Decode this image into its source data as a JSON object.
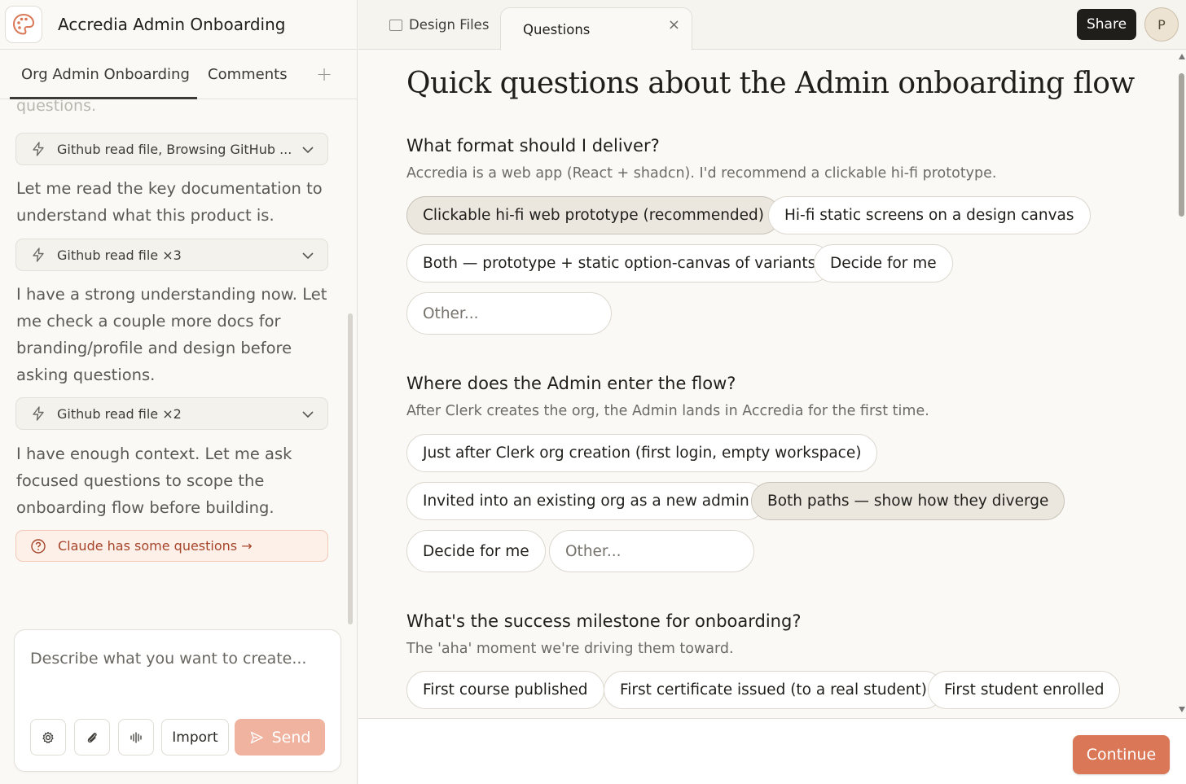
{
  "app": {
    "title": "Accredia Admin Onboarding",
    "logo_icon": "palette-icon"
  },
  "left_tabs": {
    "active": "Org Admin Onboarding",
    "second": "Comments",
    "add": "+"
  },
  "chat": {
    "faded_text": "questions.",
    "tool1": "Github read file, Browsing GitHub ...",
    "msg1": "Let me read the key documentation to understand what this product is.",
    "tool2": "Github read file ×3",
    "msg2": "I have a strong understanding now. Let me check a couple more docs for branding/profile and design before asking questions.",
    "tool3": "Github read file ×2",
    "msg3": "I have enough context. Let me ask focused questions to scope the onboarding flow before building.",
    "questions_link": "Claude has some questions →"
  },
  "composer": {
    "placeholder": "Describe what you want to create...",
    "import_label": "Import",
    "send_label": "Send"
  },
  "file_tabs": {
    "design": "Design Files",
    "questions": "Questions",
    "close": "×"
  },
  "share_label": "Share",
  "avatar_initial": "P",
  "page_title": "Quick questions about the Admin onboarding flow",
  "q1": {
    "title": "What format should I deliver?",
    "sub": "Accredia is a web app (React + shadcn). I'd recommend a clickable hi-fi prototype.",
    "options": [
      "Clickable hi-fi web prototype (recommended)",
      "Hi-fi static screens on a design canvas",
      "Both — prototype + static option-canvas of variants",
      "Decide for me"
    ],
    "other": "Other..."
  },
  "q2": {
    "title": "Where does the Admin enter the flow?",
    "sub": "After Clerk creates the org, the Admin lands in Accredia for the first time.",
    "options": [
      "Just after Clerk org creation (first login, empty workspace)",
      "Invited into an existing org as a new admin",
      "Both paths — show how they diverge",
      "Decide for me"
    ],
    "other": "Other..."
  },
  "q3": {
    "title": "What's the success milestone for onboarding?",
    "sub": "The 'aha' moment we're driving them toward.",
    "options": [
      "First course published",
      "First certificate issued (to a real student)",
      "First student enrolled"
    ]
  },
  "continue_label": "Continue",
  "colors": {
    "accent": "#d97757",
    "send_disabled": "#efb39f",
    "selected_option": "#ebe7de"
  }
}
